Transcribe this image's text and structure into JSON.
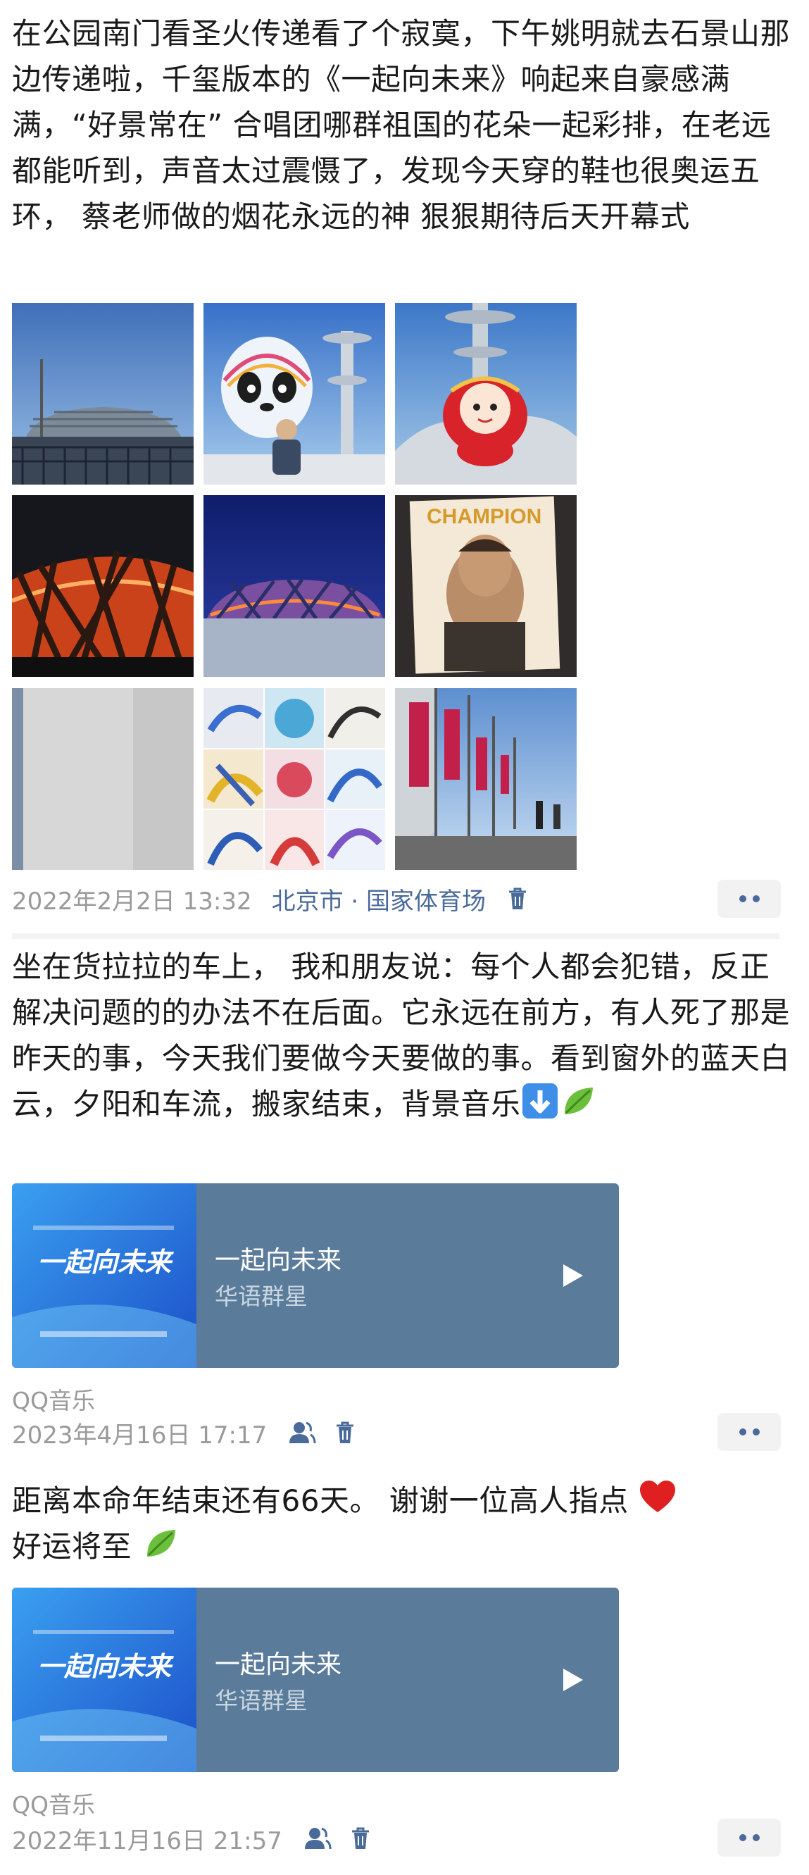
{
  "posts": [
    {
      "text": "在公园南门看圣火传递看了个寂寞，下午姚明就去石景山那边传递啦，千玺版本的《一起向未来》响起来自豪感满满，“好景常在” 合唱团哪群祖国的花朵一起彩排，在老远都能听到，声音太过震慑了，发现今天穿的鞋也很奥运五环，  蔡老师做的烟花永远的神 狠狠期待后天开幕式",
      "photo_count": 9,
      "date": "2022年2月2日 13:32",
      "location": "北京市 · 国家体育场",
      "cover_text": "CHAMPION"
    },
    {
      "text": "坐在货拉拉的车上， 我和朋友说：每个人都会犯错，反正解决问题的的办法不在后面。它永远在前方，有人死了那是昨天的事，今天我们要做今天要做的事。看到窗外的蓝天白云，夕阳和车流，搬家结束，背景音乐",
      "emojis": [
        "down-arrow",
        "leaf"
      ],
      "music": {
        "title": "一起向未来",
        "artist": "华语群星",
        "cover_title": "一起向未来"
      },
      "source": "QQ音乐",
      "date": "2023年4月16日 17:17"
    },
    {
      "text_before_heart": "距离本命年结束还有66天。 谢谢一位高人指点",
      "text_after_heart": "好运将至",
      "emojis": [
        "red-heart",
        "leaf"
      ],
      "music": {
        "title": "一起向未来",
        "artist": "华语群星",
        "cover_title": "一起向未来"
      },
      "source": "QQ音乐",
      "date": "2022年11月16日 21:57"
    }
  ],
  "colors": {
    "link": "#4a6a9a",
    "meta": "#9a9a9a",
    "music_card_bg": "#5a7c9a",
    "divider": "#f3f3f3"
  }
}
